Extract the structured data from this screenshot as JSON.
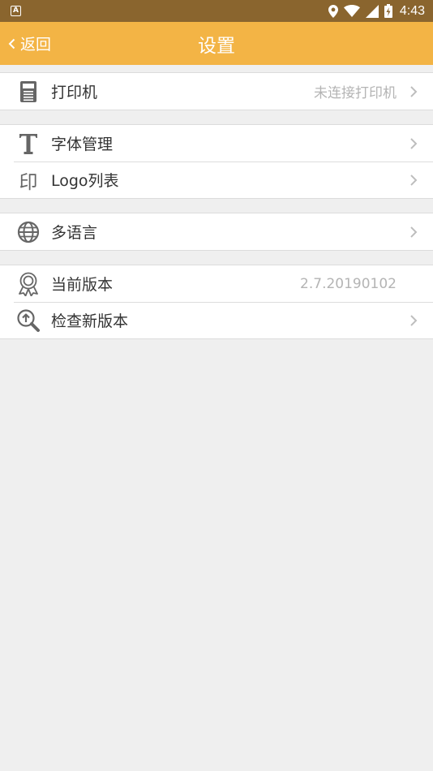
{
  "status_bar": {
    "time": "4:43",
    "icons": [
      "app-a-icon",
      "location-icon",
      "wifi-icon",
      "signal-icon",
      "battery-charging-icon"
    ]
  },
  "app_bar": {
    "back_label": "返回",
    "title": "设置",
    "color": "#f3b445"
  },
  "groups": [
    {
      "rows": [
        {
          "icon": "printer-icon",
          "label": "打印机",
          "value": "未连接打印机",
          "chevron": true
        }
      ]
    },
    {
      "rows": [
        {
          "icon": "font-t-icon",
          "label": "字体管理",
          "value": "",
          "chevron": true
        },
        {
          "icon": "seal-yin-icon",
          "label": "Logo列表",
          "value": "",
          "chevron": true
        }
      ]
    },
    {
      "rows": [
        {
          "icon": "globe-icon",
          "label": "多语言",
          "value": "",
          "chevron": true
        }
      ]
    },
    {
      "rows": [
        {
          "icon": "award-badge-icon",
          "label": "当前版本",
          "value": "2.7.20190102",
          "chevron": false
        },
        {
          "icon": "search-upgrade-icon",
          "label": "检查新版本",
          "value": "",
          "chevron": true
        }
      ]
    }
  ],
  "seal_glyph": "印"
}
